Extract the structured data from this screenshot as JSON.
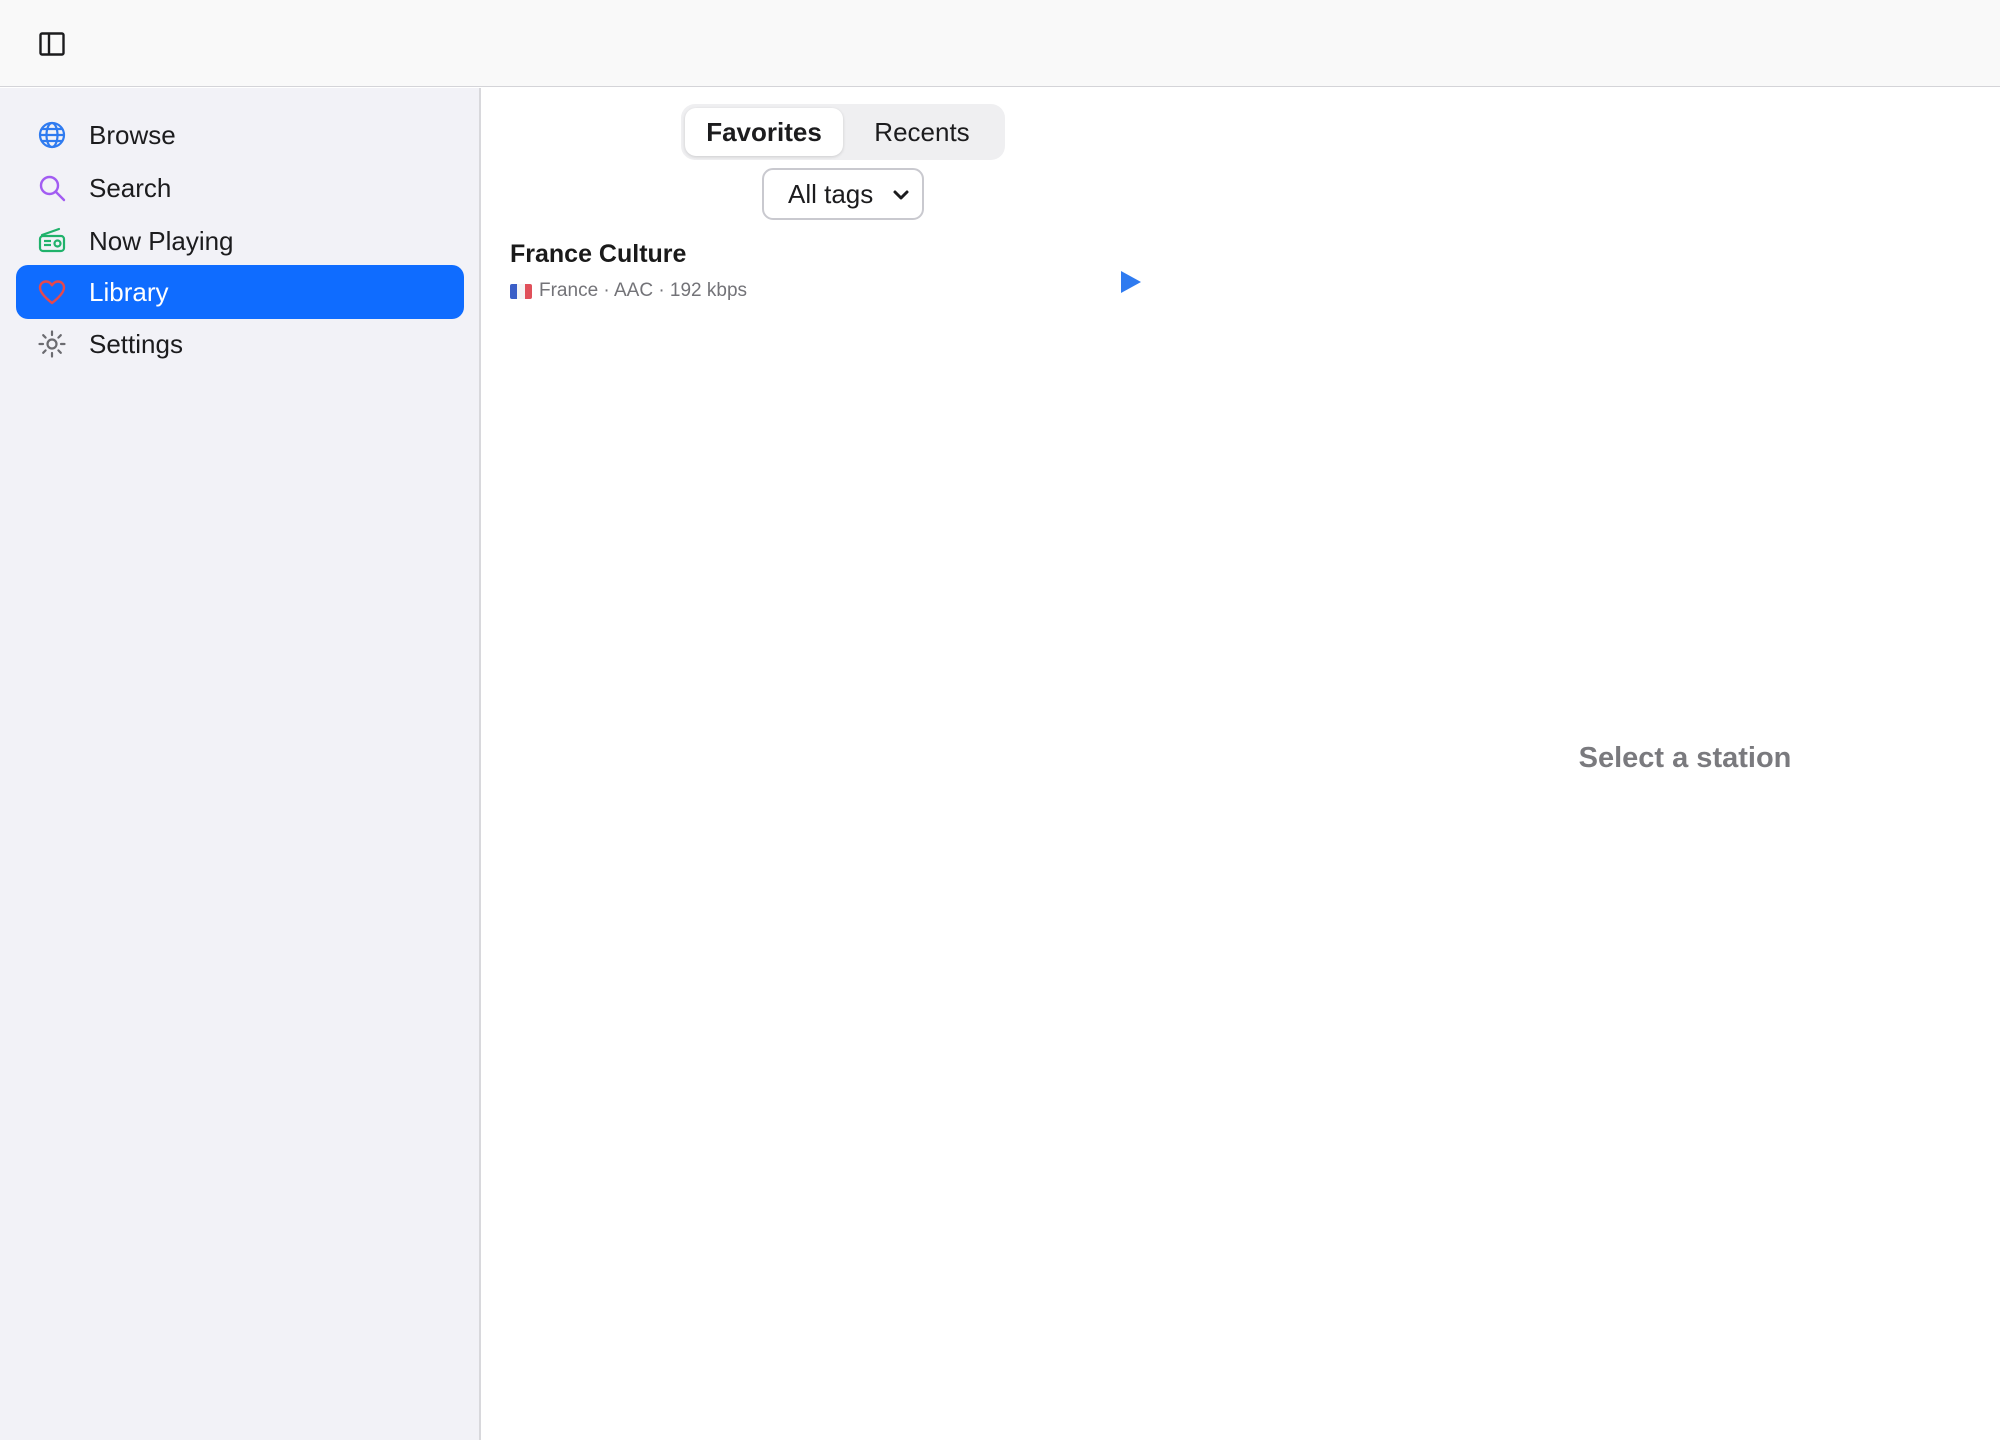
{
  "sidebar": {
    "items": [
      {
        "label": "Browse",
        "icon": "globe-icon",
        "color": "#2f7bf0"
      },
      {
        "label": "Search",
        "icon": "search-icon",
        "color": "#a25cf2"
      },
      {
        "label": "Now Playing",
        "icon": "radio-icon",
        "color": "#20b26b"
      },
      {
        "label": "Library",
        "icon": "heart-icon",
        "color": "#e5484d",
        "active": true
      },
      {
        "label": "Settings",
        "icon": "gear-icon",
        "color": "#6b6b70"
      }
    ],
    "accent": "#0f6cff"
  },
  "library": {
    "tabs": [
      {
        "label": "Favorites",
        "selected": true
      },
      {
        "label": "Recents",
        "selected": false
      }
    ],
    "tag_filter": {
      "value": "All tags"
    },
    "stations": [
      {
        "name": "France Culture",
        "country": "France",
        "codec": "AAC",
        "bitrate": "192 kbps",
        "meta": "France · AAC · 192 kbps",
        "flag": "flag-france-icon"
      }
    ]
  },
  "detail": {
    "empty_text": "Select a station"
  }
}
